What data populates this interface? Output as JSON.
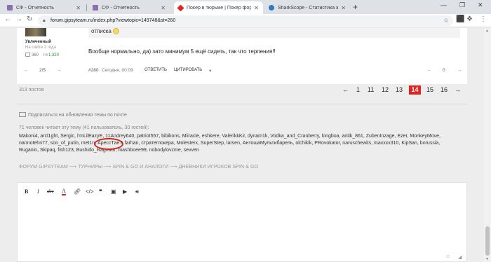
{
  "tabs": [
    {
      "title": "СФ - Отчетность",
      "favicon": "#8b6fb0",
      "active": false
    },
    {
      "title": "СФ - Отчетность",
      "favicon": "#8b6fb0",
      "active": false
    },
    {
      "title": "Покер в тюрьме | Покер форум",
      "favicon": "#e02424",
      "active": true
    },
    {
      "title": "SharkScope - Статистика живого",
      "favicon": "#2a7bbf",
      "active": false
    }
  ],
  "address": {
    "url": "forum.gipsyteam.ru/index.php?viewtopic=149748&st=260"
  },
  "post": {
    "author_status": "Увлеченный",
    "author_joined": "На сайте 2 года",
    "author_posts": "360",
    "author_likes": "1,320",
    "quote_text": "отписка",
    "text": "Вообще нормально, да) зато минимум 5 ещё сидеть, так что терпения!!",
    "bar": {
      "page_indicator": "2/5",
      "post_number": "#280",
      "timestamp": "Сегодня, 00:09",
      "reply_label": "ОТВЕТИТЬ",
      "quote_label": "ЦИТИРОВАТЬ",
      "likes": "0"
    }
  },
  "topic": {
    "posts_count": "313 постов",
    "pages": [
      "1",
      "11",
      "12",
      "13",
      "14",
      "15",
      "16"
    ],
    "current_page": "14",
    "subscribe_label": "Подписаться на обновления темы по почте",
    "readers_line": "71 человек читает эту тему (41 пользователь, 30 гостей):",
    "users_line1": "Makoni4, arcl1ght, Sergic, I'mLilEazyE, 11Andrey640, patriot557, bibikons, Miiracle, eshkere, ValerikkKir, dynam1k, Vodka_and_Cranberry, longboa, antik_861, ZubenInzage, Ezer, MonkeyMove,",
    "users_line2": "nannotehn77, son_of_putin, met1n, АрессТанТ, farhan, стратегпокера, Molesterx, SuperStep, larsen, АнтошаМультибарель, olchikik, PRovokator, naruschewits, maxxxx310, KipSan, borussia,",
    "users_line3": "Ruganin, Skipaq, fish123, Bushido_Ragnaor, mashboee99, nobodylovzme, sevven",
    "breadcrumbs": [
      "ФОРУМ GIPSYTEAM",
      "ТУРНИРЫ",
      "SPIN & GO И АНАЛОГИ",
      "ДНЕВНИКИ ИГРОКОВ SPIN & GO"
    ]
  },
  "editor": {
    "tools": [
      "B",
      "I",
      "abc",
      "A",
      "link-icon",
      "code-icon",
      "quote-icon",
      "image-icon",
      "video-icon",
      "audio-icon"
    ]
  }
}
